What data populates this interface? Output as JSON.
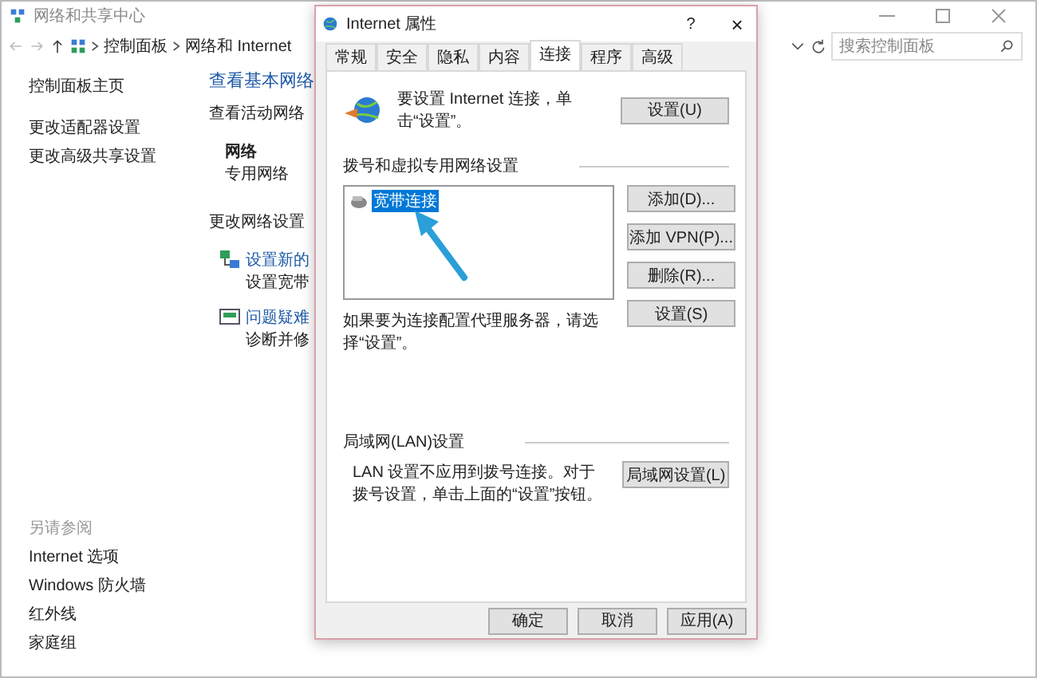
{
  "main_window": {
    "title": "网络和共享中心",
    "breadcrumb": [
      "控制面板",
      "网络和 Internet"
    ],
    "search": {
      "placeholder": "搜索控制面板"
    }
  },
  "sidebar": {
    "items": [
      "控制面板主页",
      "更改适配器设置",
      "更改高级共享设置"
    ],
    "see_also": {
      "heading": "另请参阅",
      "items": [
        "Internet 选项",
        "Windows 防火墙",
        "红外线",
        "家庭组"
      ]
    }
  },
  "content": {
    "heading": "查看基本网络",
    "active_networks": {
      "heading": "查看活动网络",
      "name": "网络",
      "type": "专用网络"
    },
    "change_settings": {
      "heading": "更改网络设置",
      "tasks": [
        {
          "link": "设置新的",
          "description": "设置宽带"
        },
        {
          "link": "问题疑难",
          "description": "诊断并修"
        }
      ]
    }
  },
  "dialog": {
    "title": "Internet 属性",
    "help": "?",
    "close": "×",
    "tabs": [
      {
        "label": "常规",
        "selected": false
      },
      {
        "label": "安全",
        "selected": false
      },
      {
        "label": "隐私",
        "selected": false
      },
      {
        "label": "内容",
        "selected": false
      },
      {
        "label": "连接",
        "selected": true
      },
      {
        "label": "程序",
        "selected": false
      },
      {
        "label": "高级",
        "selected": false
      }
    ],
    "setup": {
      "text": "要设置 Internet 连接，单击“设置”。",
      "button": "设置(U)"
    },
    "dialup": {
      "heading": "拨号和虚拟专用网络设置",
      "connections": [
        {
          "name": "宽带连接",
          "selected": true
        }
      ],
      "buttons": [
        "添加(D)...",
        "添加 VPN(P)...",
        "删除(R)...",
        "设置(S)"
      ],
      "proxy_note": "如果要为连接配置代理服务器，请选择“设置”。"
    },
    "lan": {
      "heading": "局域网(LAN)设置",
      "note": "LAN 设置不应用到拨号连接。对于拨号设置，单击上面的“设置”按钮。",
      "button": "局域网设置(L)"
    },
    "buttons": [
      "确定",
      "取消",
      "应用(A)"
    ]
  }
}
